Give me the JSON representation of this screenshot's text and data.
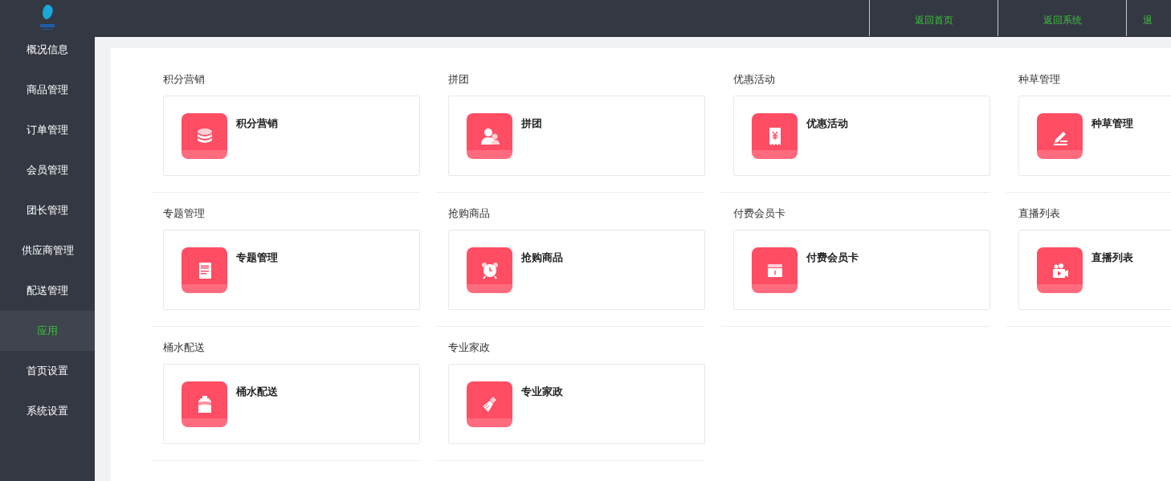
{
  "top_bar": {
    "links": [
      {
        "label": "返回首页"
      },
      {
        "label": "返回系统"
      },
      {
        "label": "退"
      }
    ]
  },
  "sidebar": {
    "items": [
      {
        "label": "概况信息",
        "selected": false
      },
      {
        "label": "商品管理",
        "selected": false
      },
      {
        "label": "订单管理",
        "selected": false
      },
      {
        "label": "会员管理",
        "selected": false
      },
      {
        "label": "团长管理",
        "selected": false
      },
      {
        "label": "供应商管理",
        "selected": false
      },
      {
        "label": "配送管理",
        "selected": false
      },
      {
        "label": "应用",
        "selected": true
      },
      {
        "label": "首页设置",
        "selected": false
      },
      {
        "label": "系统设置",
        "selected": false
      }
    ]
  },
  "apps": [
    {
      "group": "积分营销",
      "title": "积分营销",
      "kind": "coins"
    },
    {
      "group": "拼团",
      "title": "拼团",
      "kind": "users"
    },
    {
      "group": "优惠活动",
      "title": "优惠活动",
      "kind": "receipt"
    },
    {
      "group": "种草管理",
      "title": "种草管理",
      "kind": "pencil"
    },
    {
      "group": "专题管理",
      "title": "专题管理",
      "kind": "document"
    },
    {
      "group": "抢购商品",
      "title": "抢购商品",
      "kind": "alarm"
    },
    {
      "group": "付费会员卡",
      "title": "付费会员卡",
      "kind": "card"
    },
    {
      "group": "直播列表",
      "title": "直播列表",
      "kind": "video"
    },
    {
      "group": "桶水配送",
      "title": "桶水配送",
      "kind": "bottle"
    },
    {
      "group": "专业家政",
      "title": "专业家政",
      "kind": "broom"
    }
  ]
}
